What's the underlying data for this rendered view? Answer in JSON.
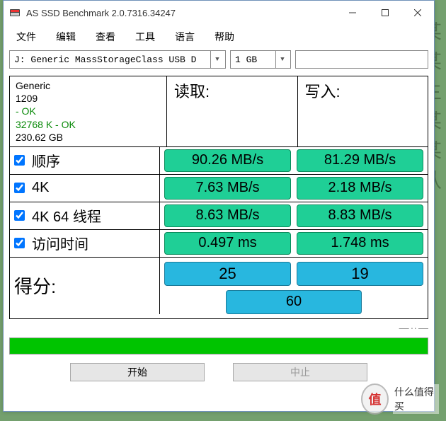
{
  "window": {
    "title": "AS SSD Benchmark 2.0.7316.34247"
  },
  "menu": {
    "file": "文件",
    "edit": "编辑",
    "view": "查看",
    "tools": "工具",
    "language": "语言",
    "help": "帮助"
  },
  "toolbar": {
    "drive": "J: Generic MassStorageClass USB D",
    "size": "1 GB"
  },
  "device": {
    "name": "Generic",
    "model": "1209",
    "status": " - OK",
    "block": "32768 K - OK",
    "capacity": "230.62 GB"
  },
  "headers": {
    "read": "读取:",
    "write": "写入:"
  },
  "tests": {
    "seq": {
      "label": "顺序",
      "checked": true,
      "read": "90.26 MB/s",
      "write": "81.29 MB/s"
    },
    "r4k": {
      "label": "4K",
      "checked": true,
      "read": "7.63 MB/s",
      "write": "2.18 MB/s"
    },
    "r4k64": {
      "label": "4K 64 线程",
      "checked": true,
      "read": "8.63 MB/s",
      "write": "8.83 MB/s"
    },
    "access": {
      "label": "访问时间",
      "checked": true,
      "read": "0.497 ms",
      "write": "1.748 ms"
    }
  },
  "score": {
    "label": "得分:",
    "read": "25",
    "write": "19",
    "total": "60"
  },
  "buttons": {
    "start": "开始",
    "abort": "中止"
  },
  "watermark": {
    "text": "什么值得买"
  }
}
